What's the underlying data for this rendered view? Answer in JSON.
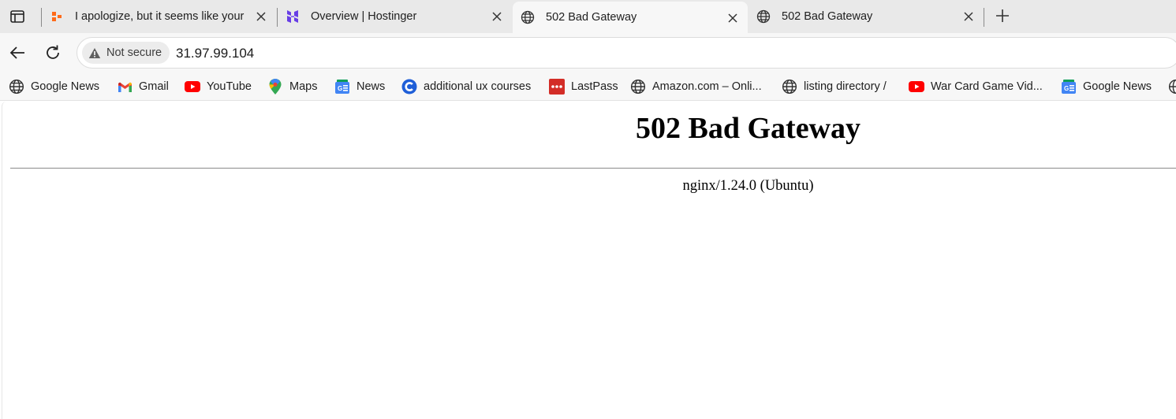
{
  "tabs": [
    {
      "title": "I apologize, but it seems like your",
      "favicon": "orange-squares-icon"
    },
    {
      "title": "Overview | Hostinger",
      "favicon": "hostinger-logo-icon"
    },
    {
      "title": "502 Bad Gateway",
      "favicon": "globe-icon",
      "active": true
    },
    {
      "title": "502 Bad Gateway",
      "favicon": "globe-icon"
    }
  ],
  "address_bar": {
    "security_label": "Not secure",
    "url": "31.97.99.104"
  },
  "bookmarks": [
    {
      "label": "Google News",
      "icon": "globe-icon"
    },
    {
      "label": "Gmail",
      "icon": "gmail-icon"
    },
    {
      "label": "YouTube",
      "icon": "youtube-icon"
    },
    {
      "label": "Maps",
      "icon": "maps-pin-icon"
    },
    {
      "label": "News",
      "icon": "google-news-icon"
    },
    {
      "label": "additional ux courses",
      "icon": "c-logo-icon"
    },
    {
      "label": "LastPass",
      "icon": "lastpass-icon"
    },
    {
      "label": "Amazon.com – Onli...",
      "icon": "globe-icon"
    },
    {
      "label": "listing directory /",
      "icon": "globe-icon"
    },
    {
      "label": "War Card Game Vid...",
      "icon": "youtube-icon"
    },
    {
      "label": "Google News",
      "icon": "google-news-icon"
    }
  ],
  "page": {
    "heading": "502 Bad Gateway",
    "server": "nginx/1.24.0 (Ubuntu)"
  },
  "colors": {
    "tabstrip_bg": "#e9e9e9",
    "toolbar_bg": "#f7f7f7",
    "youtube_red": "#ff0000",
    "lastpass_red": "#d32d27",
    "hostinger_purple": "#673de6",
    "orange": "#ff6b1a"
  }
}
